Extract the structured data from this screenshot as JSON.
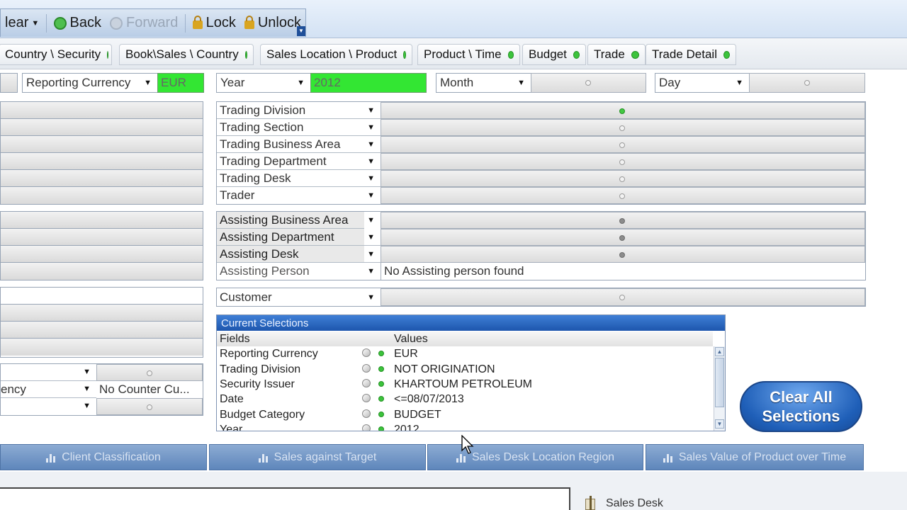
{
  "toolbar": {
    "clear_label": "lear",
    "back_label": "Back",
    "forward_label": "Forward",
    "lock_label": "Lock",
    "unlock_label": "Unlock"
  },
  "tabs": [
    {
      "label": "Country \\ Security"
    },
    {
      "label": "Book\\Sales \\ Country"
    },
    {
      "label": "Sales Location \\ Product"
    },
    {
      "label": "Product \\ Time"
    },
    {
      "label": "Budget"
    },
    {
      "label": "Trade"
    },
    {
      "label": "Trade Detail"
    }
  ],
  "filters": {
    "reporting_currency": {
      "label": "Reporting Currency",
      "value": "EUR"
    },
    "year": {
      "label": "Year",
      "value": "2012"
    },
    "month": {
      "label": "Month"
    },
    "day": {
      "label": "Day"
    }
  },
  "trading_list": [
    {
      "label": "Trading Division"
    },
    {
      "label": "Trading Section"
    },
    {
      "label": "Trading Business Area"
    },
    {
      "label": "Trading Department"
    },
    {
      "label": "Trading Desk"
    },
    {
      "label": "Trader"
    }
  ],
  "assisting_list": [
    {
      "label": "Assisting Business Area"
    },
    {
      "label": "Assisting Department"
    },
    {
      "label": "Assisting Desk"
    },
    {
      "label": "Assisting Person",
      "value": "No Assisting person found"
    }
  ],
  "customer": {
    "label": "Customer"
  },
  "left_lists": {
    "row2_label": "ency",
    "row2_value": "No  Counter  Cu..."
  },
  "current_selections": {
    "title": "Current Selections",
    "fields_header": "Fields",
    "values_header": "Values",
    "rows": [
      {
        "field": "Reporting Currency",
        "value": "EUR"
      },
      {
        "field": "Trading Division",
        "value": "NOT ORIGINATION"
      },
      {
        "field": "Security Issuer",
        "value": "KHARTOUM PETROLEUM"
      },
      {
        "field": "Date",
        "value": "<=08/07/2013"
      },
      {
        "field": "Budget Category",
        "value": "BUDGET"
      },
      {
        "field": "Year",
        "value": "2012"
      }
    ]
  },
  "clear_all": {
    "line1": "Clear All",
    "line2": "Selections"
  },
  "chart_tabs": [
    {
      "label": "Client Classification"
    },
    {
      "label": "Sales against Target"
    },
    {
      "label": "Sales Desk Location Region"
    },
    {
      "label": "Sales Value of Product over Time"
    }
  ],
  "bottom": {
    "sales_desk_label": "Sales Desk"
  }
}
